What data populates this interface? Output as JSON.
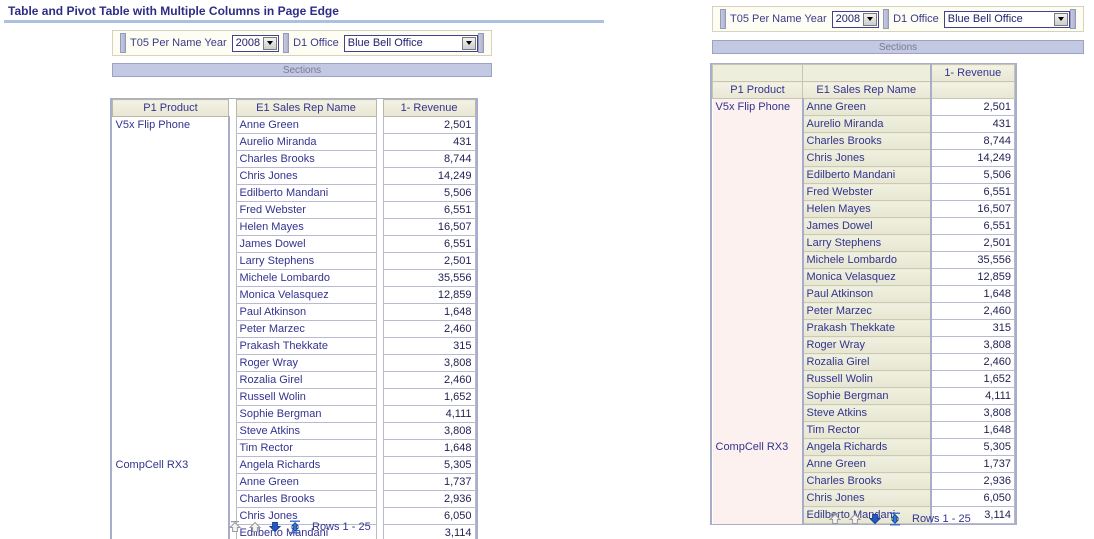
{
  "report": {
    "title": "Table and Pivot Table with Multiple Columns in Page Edge"
  },
  "prompts": {
    "year": {
      "label": "T05 Per Name Year",
      "value": "2008",
      "options": [
        "2008"
      ]
    },
    "office": {
      "label": "D1 Office",
      "value": "Blue Bell Office",
      "options": [
        "Blue Bell Office"
      ]
    }
  },
  "sections_bar": {
    "label": "Sections"
  },
  "left_view": {
    "columns": [
      "P1 Product",
      "E1 Sales Rep Name",
      "1- Revenue"
    ],
    "rows": [
      {
        "product": "V5x Flip Phone",
        "rep": "Anne Green",
        "revenue": "2,501"
      },
      {
        "product": "",
        "rep": "Aurelio Miranda",
        "revenue": "431"
      },
      {
        "product": "",
        "rep": "Charles Brooks",
        "revenue": "8,744"
      },
      {
        "product": "",
        "rep": "Chris Jones",
        "revenue": "14,249"
      },
      {
        "product": "",
        "rep": "Edilberto Mandani",
        "revenue": "5,506"
      },
      {
        "product": "",
        "rep": "Fred Webster",
        "revenue": "6,551"
      },
      {
        "product": "",
        "rep": "Helen Mayes",
        "revenue": "16,507"
      },
      {
        "product": "",
        "rep": "James Dowel",
        "revenue": "6,551"
      },
      {
        "product": "",
        "rep": "Larry Stephens",
        "revenue": "2,501"
      },
      {
        "product": "",
        "rep": "Michele Lombardo",
        "revenue": "35,556"
      },
      {
        "product": "",
        "rep": "Monica Velasquez",
        "revenue": "12,859"
      },
      {
        "product": "",
        "rep": "Paul Atkinson",
        "revenue": "1,648"
      },
      {
        "product": "",
        "rep": "Peter Marzec",
        "revenue": "2,460"
      },
      {
        "product": "",
        "rep": "Prakash Thekkate",
        "revenue": "315"
      },
      {
        "product": "",
        "rep": "Roger Wray",
        "revenue": "3,808"
      },
      {
        "product": "",
        "rep": "Rozalia Girel",
        "revenue": "2,460"
      },
      {
        "product": "",
        "rep": "Russell Wolin",
        "revenue": "1,652"
      },
      {
        "product": "",
        "rep": "Sophie Bergman",
        "revenue": "4,111"
      },
      {
        "product": "",
        "rep": "Steve Atkins",
        "revenue": "3,808"
      },
      {
        "product": "",
        "rep": "Tim Rector",
        "revenue": "1,648"
      },
      {
        "product": "CompCell RX3",
        "rep": "Angela Richards",
        "revenue": "5,305"
      },
      {
        "product": "",
        "rep": "Anne Green",
        "revenue": "1,737"
      },
      {
        "product": "",
        "rep": "Charles Brooks",
        "revenue": "2,936"
      },
      {
        "product": "",
        "rep": "Chris Jones",
        "revenue": "6,050"
      },
      {
        "product": "",
        "rep": "Edilberto Mandani",
        "revenue": "3,114"
      }
    ],
    "footer": {
      "rows_label": "Rows 1 - 25",
      "icons": [
        "first-page-up-icon",
        "previous-page-up-icon",
        "next-page-down-icon",
        "all-rows-updown-icon"
      ]
    }
  },
  "right_view": {
    "measure_header": "1- Revenue",
    "columns": [
      "P1 Product",
      "E1 Sales Rep Name"
    ],
    "rows": [
      {
        "product": "V5x Flip Phone",
        "rep": "Anne Green",
        "revenue": "2,501"
      },
      {
        "product": "",
        "rep": "Aurelio Miranda",
        "revenue": "431"
      },
      {
        "product": "",
        "rep": "Charles Brooks",
        "revenue": "8,744"
      },
      {
        "product": "",
        "rep": "Chris Jones",
        "revenue": "14,249"
      },
      {
        "product": "",
        "rep": "Edilberto Mandani",
        "revenue": "5,506"
      },
      {
        "product": "",
        "rep": "Fred Webster",
        "revenue": "6,551"
      },
      {
        "product": "",
        "rep": "Helen Mayes",
        "revenue": "16,507"
      },
      {
        "product": "",
        "rep": "James Dowel",
        "revenue": "6,551"
      },
      {
        "product": "",
        "rep": "Larry Stephens",
        "revenue": "2,501"
      },
      {
        "product": "",
        "rep": "Michele Lombardo",
        "revenue": "35,556"
      },
      {
        "product": "",
        "rep": "Monica Velasquez",
        "revenue": "12,859"
      },
      {
        "product": "",
        "rep": "Paul Atkinson",
        "revenue": "1,648"
      },
      {
        "product": "",
        "rep": "Peter Marzec",
        "revenue": "2,460"
      },
      {
        "product": "",
        "rep": "Prakash Thekkate",
        "revenue": "315"
      },
      {
        "product": "",
        "rep": "Roger Wray",
        "revenue": "3,808"
      },
      {
        "product": "",
        "rep": "Rozalia Girel",
        "revenue": "2,460"
      },
      {
        "product": "",
        "rep": "Russell Wolin",
        "revenue": "1,652"
      },
      {
        "product": "",
        "rep": "Sophie Bergman",
        "revenue": "4,111"
      },
      {
        "product": "",
        "rep": "Steve Atkins",
        "revenue": "3,808"
      },
      {
        "product": "",
        "rep": "Tim Rector",
        "revenue": "1,648"
      },
      {
        "product": "CompCell RX3",
        "rep": "Angela Richards",
        "revenue": "5,305"
      },
      {
        "product": "",
        "rep": "Anne Green",
        "revenue": "1,737"
      },
      {
        "product": "",
        "rep": "Charles Brooks",
        "revenue": "2,936"
      },
      {
        "product": "",
        "rep": "Chris Jones",
        "revenue": "6,050"
      },
      {
        "product": "",
        "rep": "Edilberto Mandani",
        "revenue": "3,114"
      }
    ],
    "footer": {
      "rows_label": "Rows 1 - 25",
      "icons": [
        "first-page-up-icon",
        "previous-page-up-icon",
        "next-page-down-icon",
        "all-rows-updown-icon"
      ]
    }
  },
  "colors": {
    "title_text": "#2d2d86",
    "title_rule": "#aac2e0",
    "sections_bar": "#c3c8e3",
    "header_cream": "#eeeedc",
    "product_pink": "#fdf1ef",
    "link_blue": "#33338f",
    "arrow_blue": "#2358c5"
  }
}
